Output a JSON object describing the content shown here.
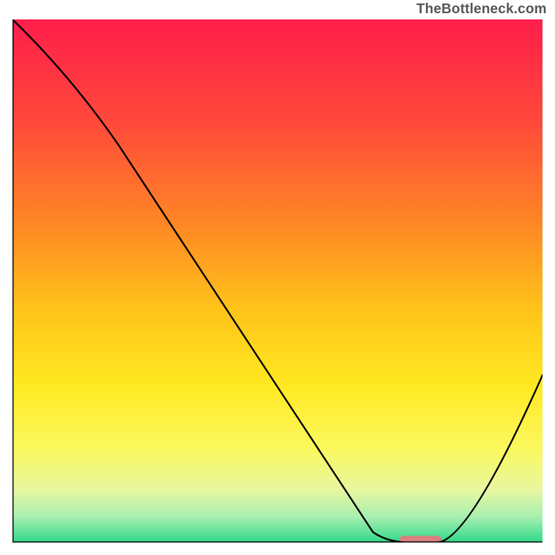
{
  "watermark": "TheBottleneck.com",
  "chart_data": {
    "type": "line",
    "title": "",
    "xlabel": "",
    "ylabel": "",
    "xlim": [
      0,
      100
    ],
    "ylim": [
      0,
      100
    ],
    "grid": false,
    "series": [
      {
        "name": "curve",
        "x": [
          0,
          20,
          68,
          75,
          80,
          100
        ],
        "y": [
          100,
          76,
          2,
          0,
          0,
          32
        ]
      }
    ],
    "background_gradient": {
      "stops": [
        {
          "offset": 0.0,
          "color": "#ff1e4b"
        },
        {
          "offset": 0.2,
          "color": "#ff4a3a"
        },
        {
          "offset": 0.4,
          "color": "#ff8a24"
        },
        {
          "offset": 0.55,
          "color": "#ffc21a"
        },
        {
          "offset": 0.7,
          "color": "#ffe921"
        },
        {
          "offset": 0.82,
          "color": "#fbf85e"
        },
        {
          "offset": 0.9,
          "color": "#e7f7a0"
        },
        {
          "offset": 0.95,
          "color": "#a9efb0"
        },
        {
          "offset": 1.0,
          "color": "#2fd98a"
        }
      ]
    },
    "marker": {
      "x": 77,
      "y": 0.5,
      "width_pct": 8,
      "height_pct": 1.6,
      "color": "#d98080",
      "rx": 6
    },
    "axes": {
      "stroke": "#000000",
      "stroke_width": 3
    },
    "curve_style": {
      "stroke": "#000000",
      "stroke_width": 2.5
    }
  }
}
